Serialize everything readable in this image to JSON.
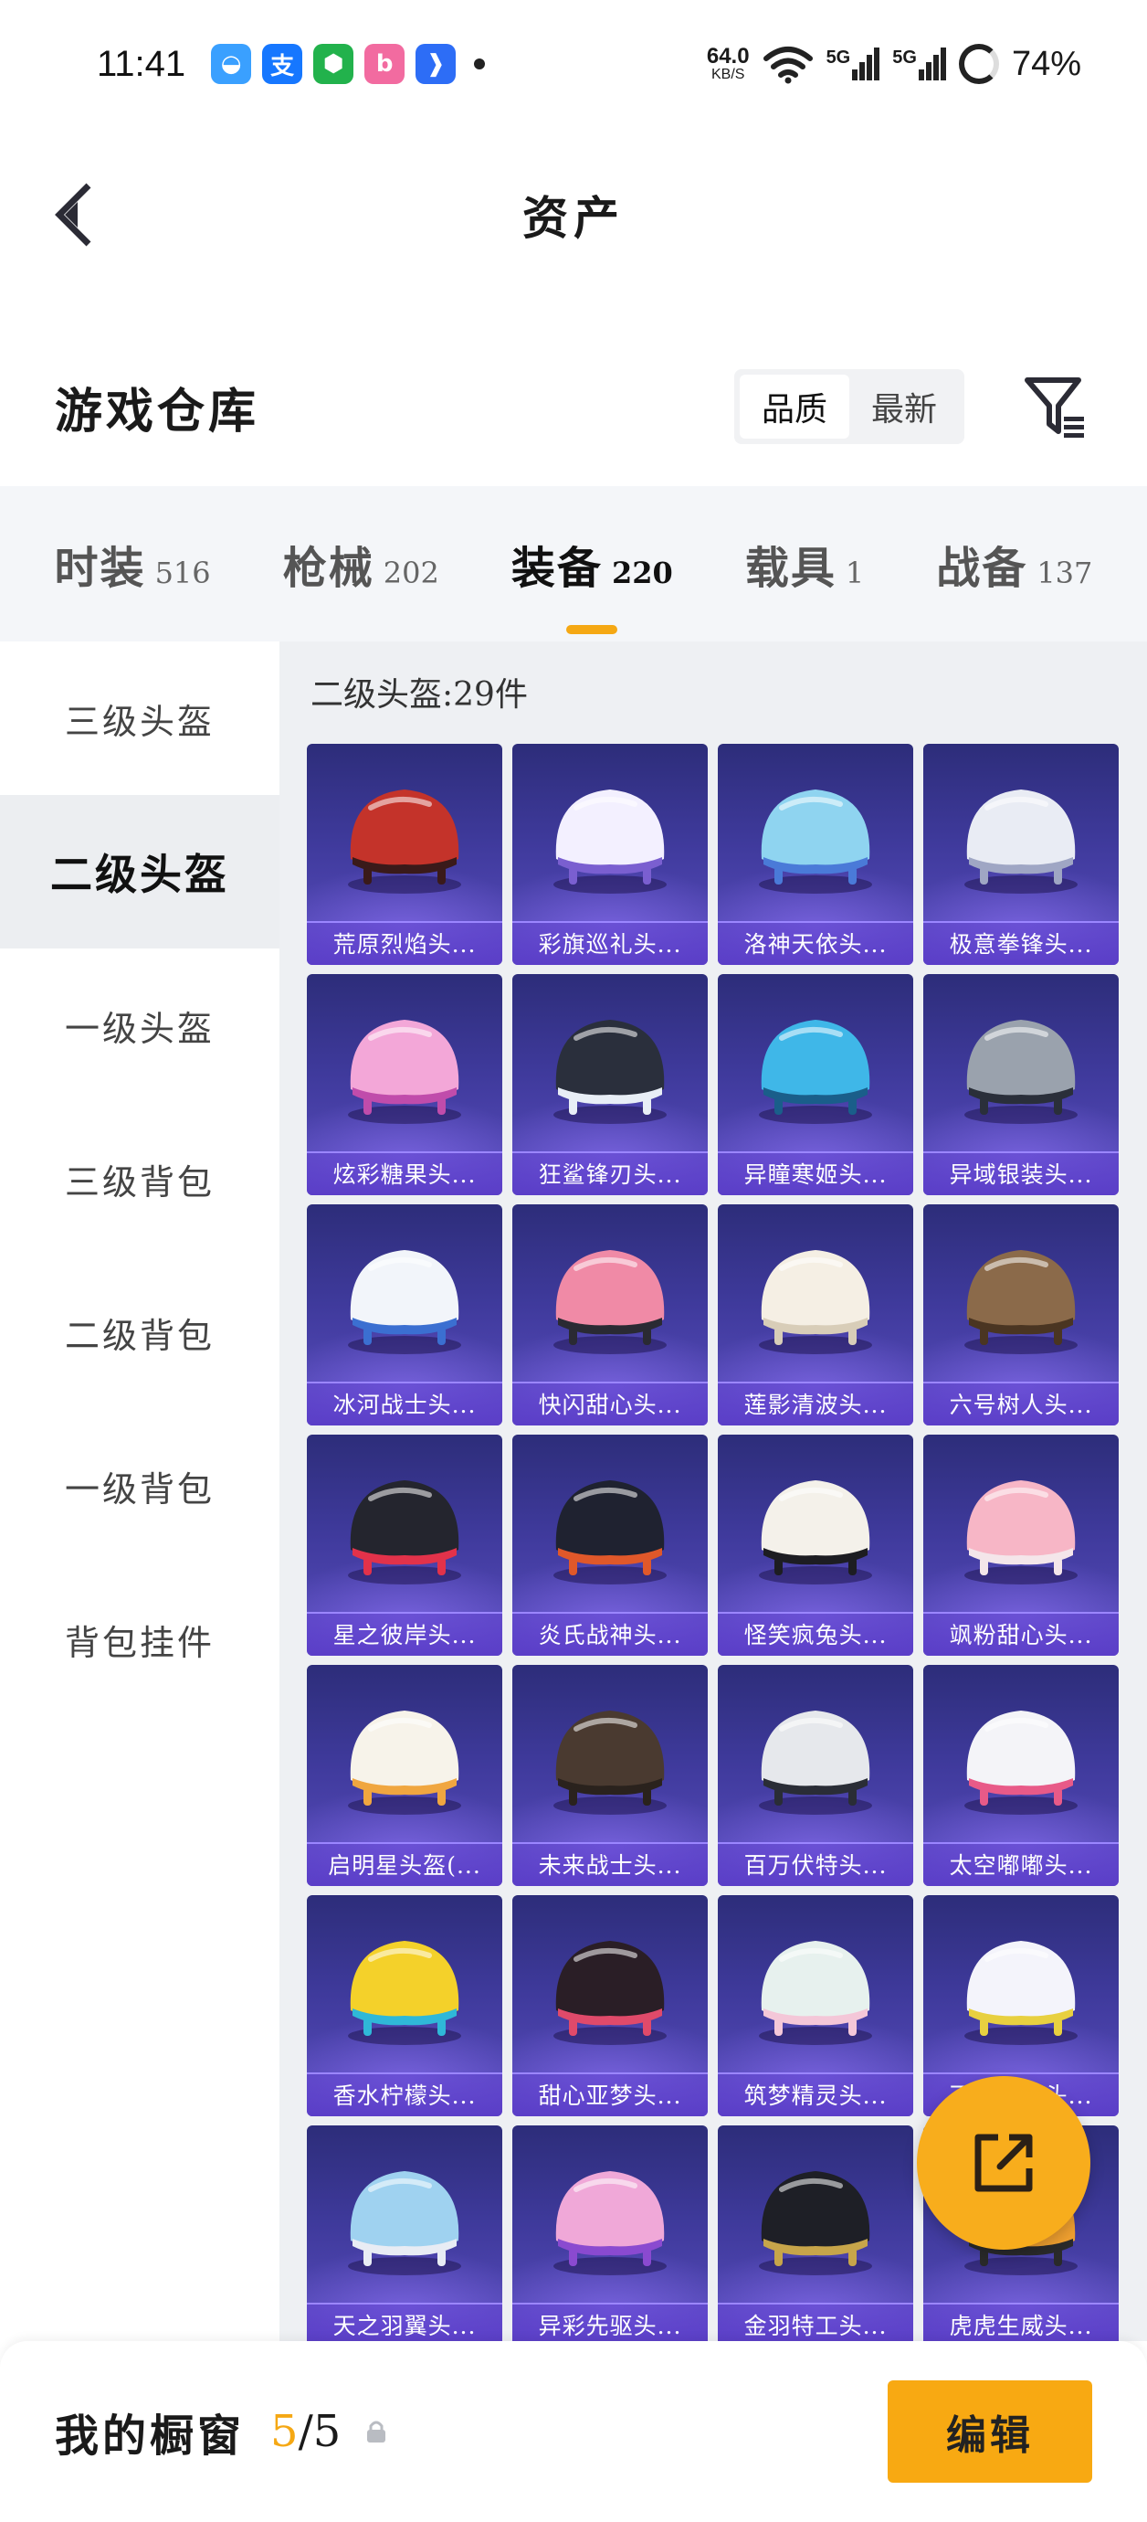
{
  "status_bar": {
    "time": "11:41",
    "apps": [
      {
        "icon": "qq-browser-icon",
        "color": "#3aa0ff",
        "glyph": "◒"
      },
      {
        "icon": "alipay-icon",
        "color": "#1677ff",
        "glyph": "支"
      },
      {
        "icon": "security-shield-icon",
        "color": "#22b24c",
        "glyph": "⬢"
      },
      {
        "icon": "bilibili-icon",
        "color": "#f26ba0",
        "glyph": "b"
      },
      {
        "icon": "feishu-icon",
        "color": "#2d6df6",
        "glyph": "❱"
      }
    ],
    "net_speed": "64.0",
    "net_unit": "KB/S",
    "signal1": "5G",
    "signal2": "5G",
    "battery": "74%"
  },
  "header": {
    "title": "资产",
    "back_icon": "back-arrow-icon"
  },
  "warehouse": {
    "title": "游戏仓库",
    "sort_options": [
      "品质",
      "最新"
    ],
    "sort_selected": "品质",
    "filter_icon": "filter-list-icon"
  },
  "tabs": [
    {
      "label": "时装",
      "count": "516",
      "active": false
    },
    {
      "label": "枪械",
      "count": "202",
      "active": false
    },
    {
      "label": "装备",
      "count": "220",
      "active": true
    },
    {
      "label": "载具",
      "count": "1",
      "active": false
    },
    {
      "label": "战备",
      "count": "137",
      "active": false
    }
  ],
  "sidebar": [
    {
      "label": "三级头盔",
      "active": false
    },
    {
      "label": "二级头盔",
      "active": true
    },
    {
      "label": "一级头盔",
      "active": false
    },
    {
      "label": "三级背包",
      "active": false
    },
    {
      "label": "二级背包",
      "active": false
    },
    {
      "label": "一级背包",
      "active": false
    },
    {
      "label": "背包挂件",
      "active": false
    }
  ],
  "content": {
    "header": "二级头盔:29件",
    "items": [
      {
        "name": "荒原烈焰头...",
        "c1": "#c4332a",
        "c2": "#3a1a1a"
      },
      {
        "name": "彩旗巡礼头...",
        "c1": "#f3f0ff",
        "c2": "#7a5fd0"
      },
      {
        "name": "洛神天依头...",
        "c1": "#8fd4f0",
        "c2": "#4a7ad8"
      },
      {
        "name": "极意拳锋头...",
        "c1": "#e9ecf4",
        "c2": "#9fa6c4"
      },
      {
        "name": "炫彩糖果头...",
        "c1": "#f3a7d8",
        "c2": "#c04cab"
      },
      {
        "name": "狂鲨锋刃头...",
        "c1": "#2a2f3c",
        "c2": "#e8eef6"
      },
      {
        "name": "异瞳寒姬头...",
        "c1": "#3fb7e8",
        "c2": "#1a5e8a"
      },
      {
        "name": "异域银装头...",
        "c1": "#9aa2ad",
        "c2": "#2a2f3a"
      },
      {
        "name": "冰河战士头...",
        "c1": "#f2f5fa",
        "c2": "#3b6fd1"
      },
      {
        "name": "快闪甜心头...",
        "c1": "#f08aa6",
        "c2": "#2a2a33"
      },
      {
        "name": "莲影清波头...",
        "c1": "#f5efe4",
        "c2": "#d8cdb8"
      },
      {
        "name": "六号树人头...",
        "c1": "#8b6a4a",
        "c2": "#4a3522"
      },
      {
        "name": "星之彼岸头...",
        "c1": "#24252e",
        "c2": "#e2324a"
      },
      {
        "name": "炎氏战神头...",
        "c1": "#1f2230",
        "c2": "#e0582a"
      },
      {
        "name": "怪笑疯兔头...",
        "c1": "#f4f1ea",
        "c2": "#1d1d22"
      },
      {
        "name": "飒粉甜心头...",
        "c1": "#f7b6c6",
        "c2": "#f4e6ea"
      },
      {
        "name": "启明星头盔(...",
        "c1": "#f7f3ea",
        "c2": "#f0a640"
      },
      {
        "name": "未来战士头...",
        "c1": "#4a3a30",
        "c2": "#2a221d"
      },
      {
        "name": "百万伏特头...",
        "c1": "#e6e8ec",
        "c2": "#2a2d36"
      },
      {
        "name": "太空嘟嘟头...",
        "c1": "#f4f4f8",
        "c2": "#e85a88"
      },
      {
        "name": "香水柠檬头...",
        "c1": "#f4d12a",
        "c2": "#2fb8d8"
      },
      {
        "name": "甜心亚梦头...",
        "c1": "#2a1e26",
        "c2": "#e04a6a"
      },
      {
        "name": "筑梦精灵头...",
        "c1": "#e7f1ee",
        "c2": "#f4c7d8"
      },
      {
        "name": "飞驰流影头...",
        "c1": "#f4f4fb",
        "c2": "#e8d040"
      },
      {
        "name": "天之羽翼头...",
        "c1": "#9fd2f0",
        "c2": "#e8ecf4"
      },
      {
        "name": "异彩先驱头...",
        "c1": "#f0a8d8",
        "c2": "#8a4ad0"
      },
      {
        "name": "金羽特工头...",
        "c1": "#1e1f26",
        "c2": "#c7a54a"
      },
      {
        "name": "虎虎生威头...",
        "c1": "#f0a030",
        "c2": "#2a2a2a"
      }
    ]
  },
  "fab": {
    "icon": "share-export-icon"
  },
  "bottom": {
    "title": "我的橱窗",
    "count_current": "5",
    "count_total": "/5",
    "lock_icon": "lock-icon",
    "edit_label": "编辑"
  }
}
